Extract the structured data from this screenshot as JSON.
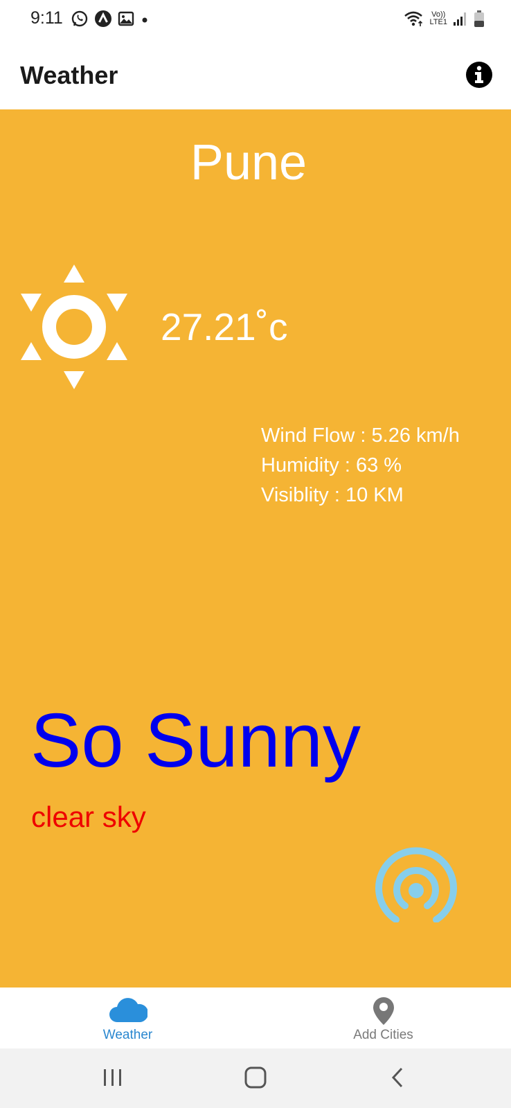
{
  "status_bar": {
    "time": "9:11",
    "left_icons": [
      "whatsapp-icon",
      "app-a-icon",
      "gallery-icon",
      "dot-icon"
    ],
    "right_icons": [
      "wifi-icon",
      "volte-icon",
      "signal-icon",
      "battery-icon"
    ],
    "volte_text_top": "Vo))",
    "volte_text_bottom": "LTE1"
  },
  "app_bar": {
    "title": "Weather",
    "info_icon": "info-icon"
  },
  "weather": {
    "city": "Pune",
    "temperature": "27.21˚c",
    "details": {
      "wind": "Wind Flow : 5.26 km/h",
      "humidity": "Humidity : 63 %",
      "visibility": "Visiblity : 10 KM"
    },
    "headline": "So Sunny",
    "description": "clear sky",
    "condition_icon": "sun-icon",
    "action_icon": "broadcast-icon"
  },
  "bottom_nav": {
    "items": [
      {
        "label": "Weather",
        "icon": "cloud-icon",
        "active": true
      },
      {
        "label": "Add Cities",
        "icon": "location-pin-icon",
        "active": false
      }
    ]
  },
  "system_nav": [
    "recent-apps-icon",
    "home-icon",
    "back-icon"
  ],
  "colors": {
    "background": "#f5b434",
    "headline": "#0000ee",
    "description": "#ee0000",
    "active_nav": "#2a87cf",
    "broadcast": "#87ceeb"
  }
}
